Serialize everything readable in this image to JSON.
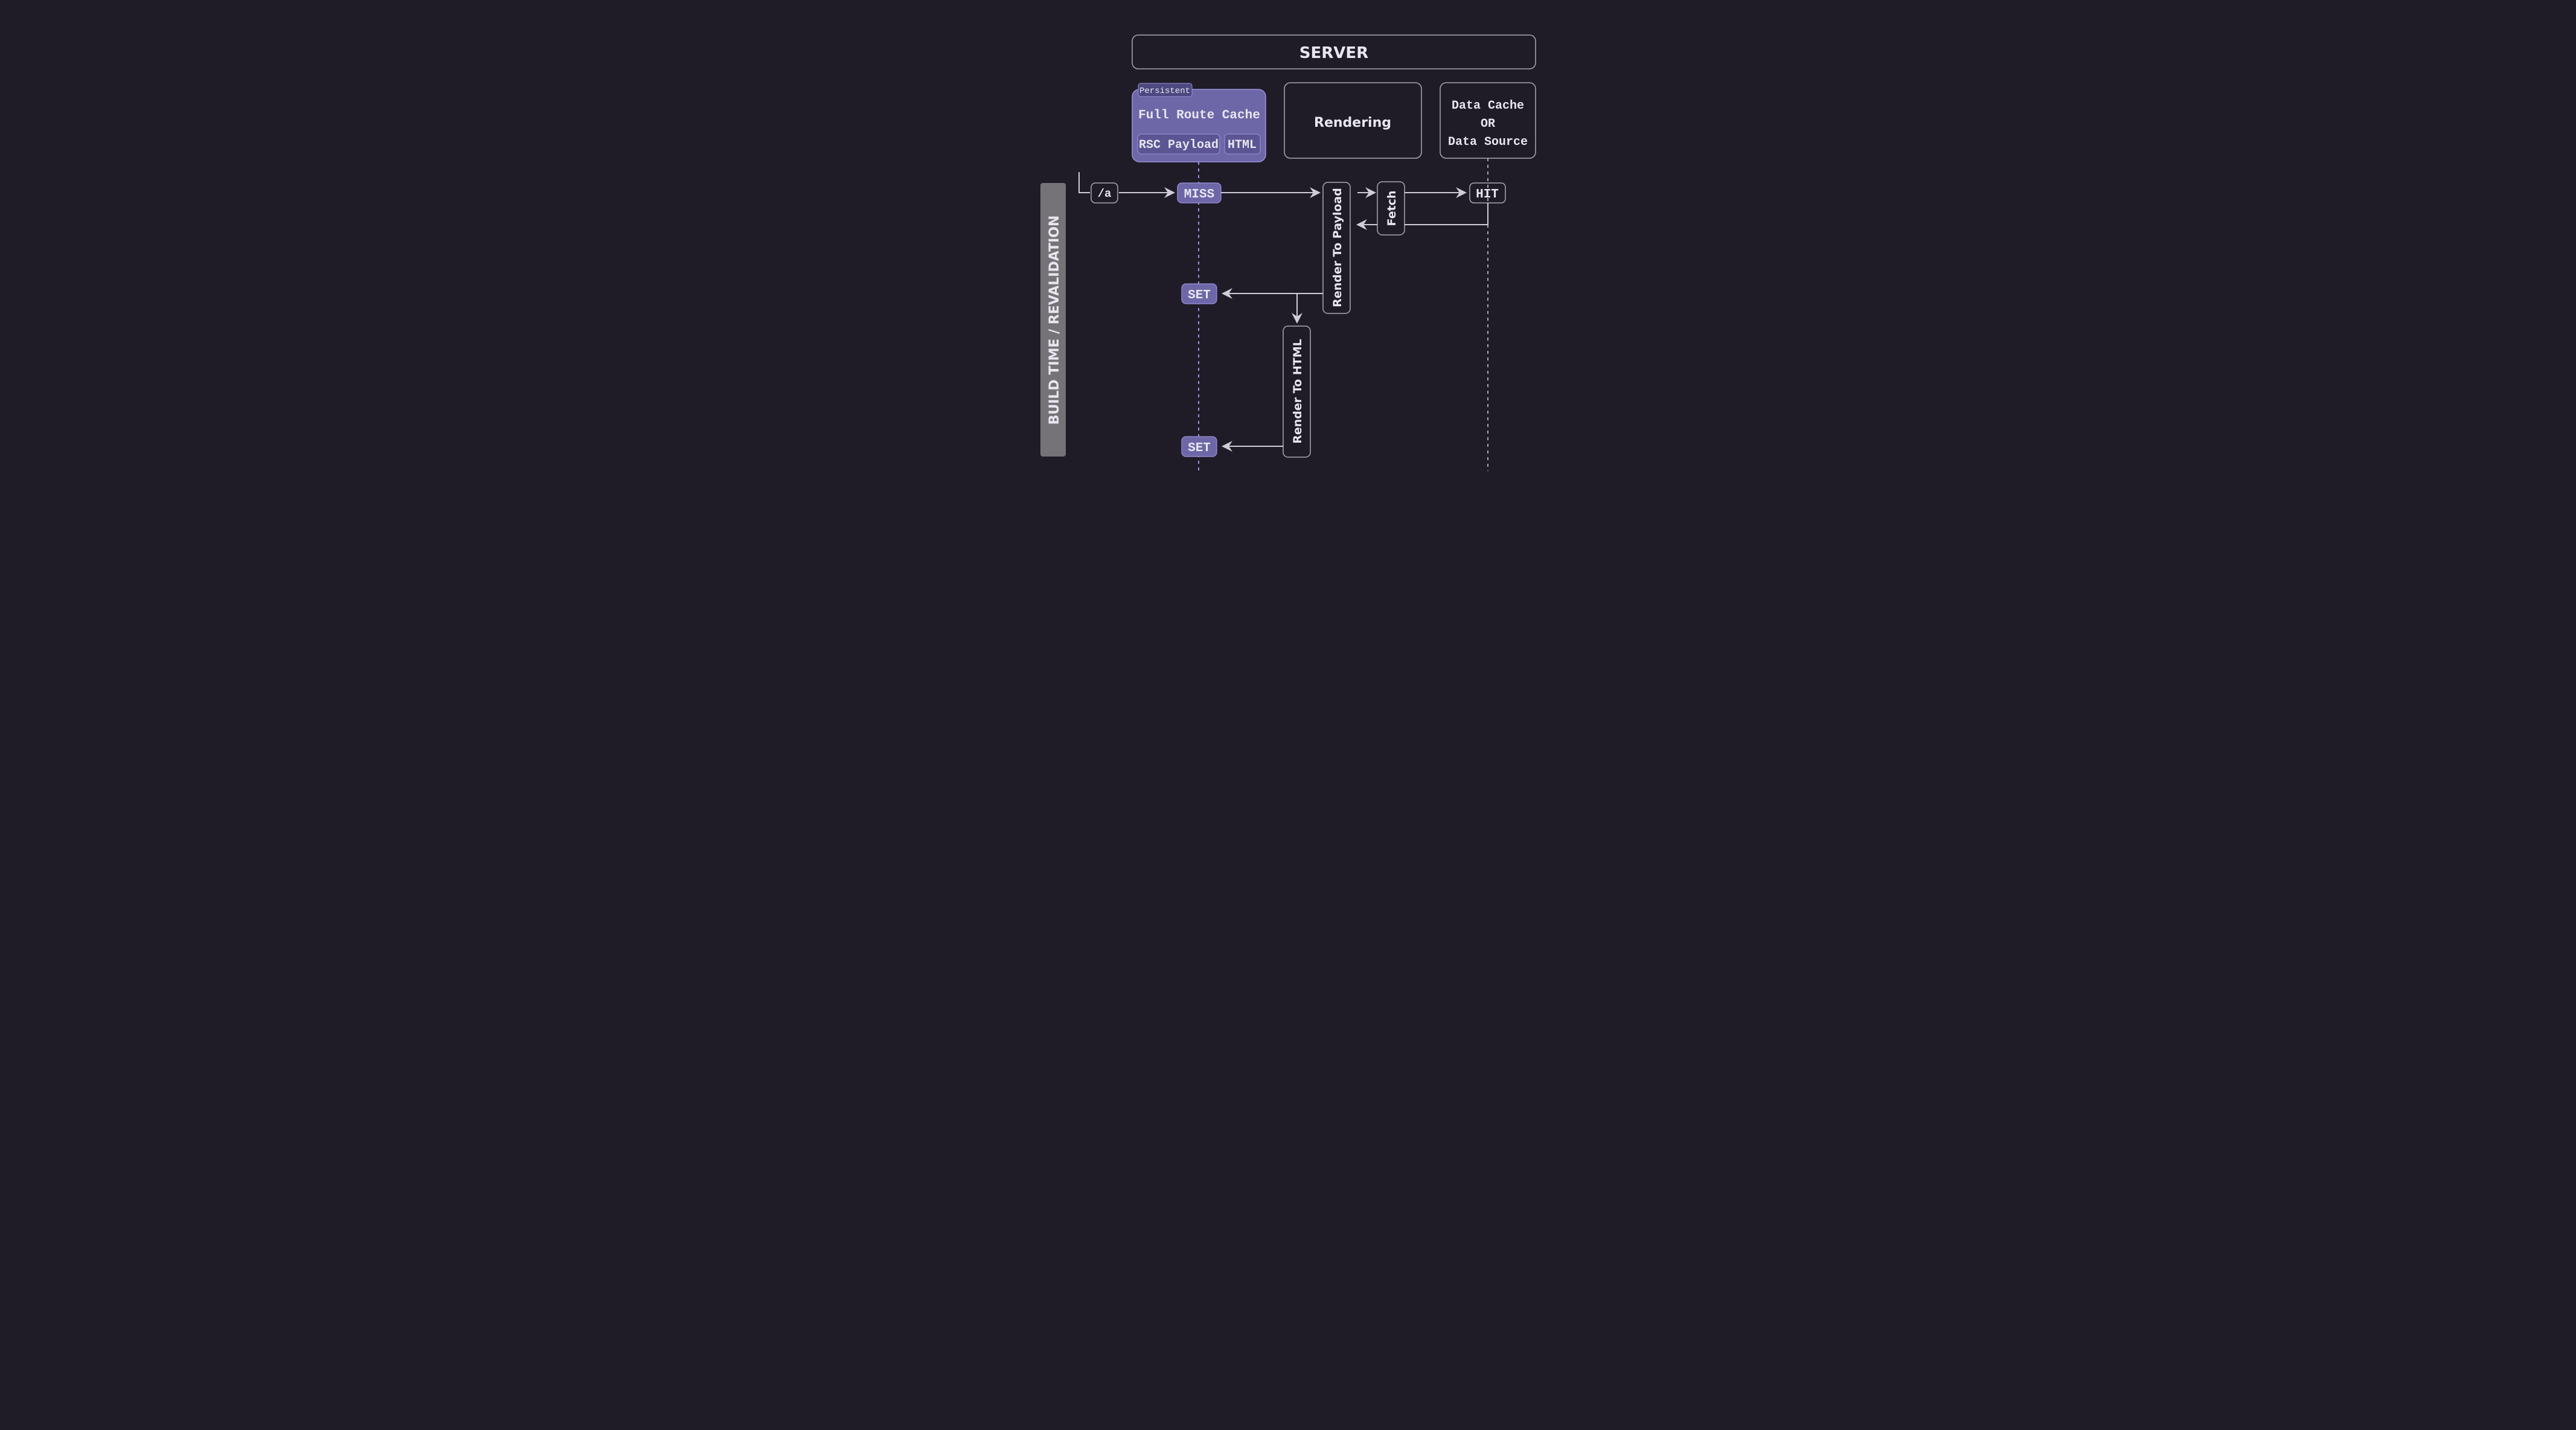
{
  "colors": {
    "bg": "#1f1c28",
    "accent": "#6d67a8",
    "accent_border": "#9b92d8",
    "grey_bar": "#767378",
    "text": "#e8e6ef",
    "line": "#cfcdd6"
  },
  "header": {
    "server": "SERVER"
  },
  "full_route_cache": {
    "persistent_tag": "Persistent",
    "title": "Full Route Cache",
    "rsc_payload": "RSC Payload",
    "html": "HTML"
  },
  "rendering": {
    "label": "Rendering"
  },
  "data_source": {
    "line1": "Data Cache",
    "line2": "OR",
    "line3": "Data Source"
  },
  "time_bar": {
    "label": "BUILD TIME / REVALIDATION"
  },
  "route": {
    "path": "/a"
  },
  "cache_ops": {
    "miss": "MISS",
    "set1": "SET",
    "set2": "SET"
  },
  "render_steps": {
    "to_payload": "Render To Payload",
    "to_html": "Render To HTML"
  },
  "fetch": {
    "label": "Fetch"
  },
  "data_hit": {
    "label": "HIT"
  }
}
